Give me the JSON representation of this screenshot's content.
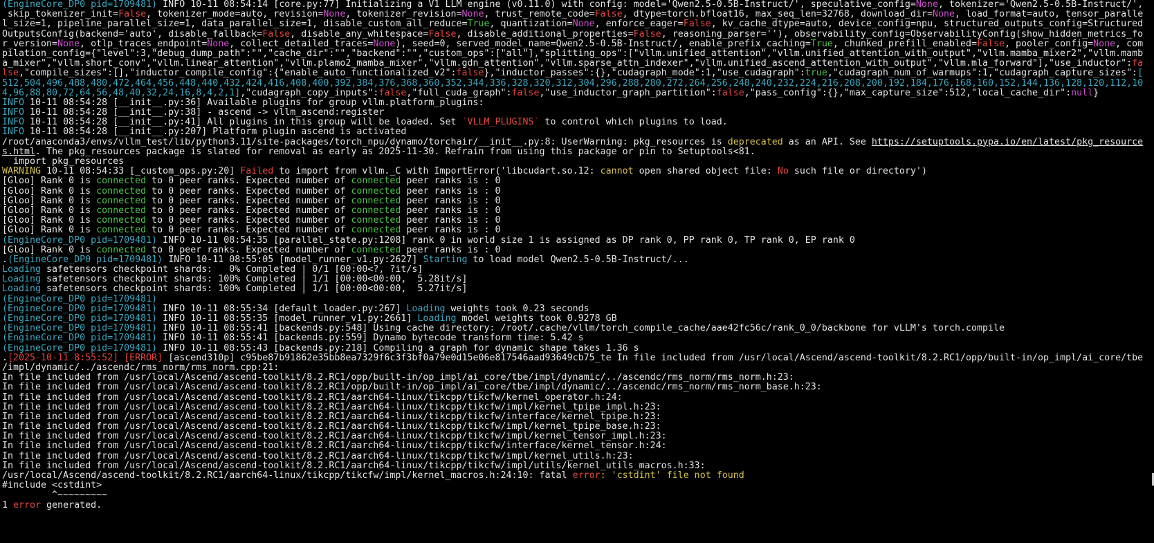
{
  "terminal": {
    "colors": {
      "background": "#000000",
      "default": "#e4e4e4",
      "cyan": "#3aa8c1",
      "red": "#e5453f",
      "green": "#4cc44c",
      "yellow": "#d7c24a",
      "magenta": "#d04fd0"
    },
    "lines": [
      [
        [
          "c",
          "(EngineCore_DP0 pid=1709481) "
        ],
        [
          "d",
          "INFO 10-11 08:54:14 [core.py:77] Initializing a V1 LLM engine (v0.11.0) with config: model='Qwen2.5-0.5B-Instruct/', speculative_config="
        ],
        [
          "m",
          "None"
        ],
        [
          "d",
          ", tokenizer='Qwen2.5-0.5B-Instruct/',"
        ]
      ],
      [
        [
          "d",
          " skip_tokenizer_init="
        ],
        [
          "r",
          "False"
        ],
        [
          "d",
          ", tokenizer_mode=auto, revision="
        ],
        [
          "m",
          "None"
        ],
        [
          "d",
          ", tokenizer_revision="
        ],
        [
          "m",
          "None"
        ],
        [
          "d",
          ", trust_remote_code="
        ],
        [
          "r",
          "False"
        ],
        [
          "d",
          ", dtype=torch.bfloat16, max_seq_len=32768, download_dir="
        ],
        [
          "m",
          "None"
        ],
        [
          "d",
          ", load_format=auto, tensor_paralle"
        ]
      ],
      [
        [
          "d",
          "l_size=1, pipeline_parallel_size=1, data_parallel_size=1, disable_custom_all_reduce="
        ],
        [
          "g",
          "True"
        ],
        [
          "d",
          ", quantization="
        ],
        [
          "m",
          "None"
        ],
        [
          "d",
          ", enforce_eager="
        ],
        [
          "r",
          "False"
        ],
        [
          "d",
          ", kv_cache_dtype=auto, device_config=npu, structured_outputs_config=Structured"
        ]
      ],
      [
        [
          "d",
          "OutputsConfig(backend='auto', disable_fallback="
        ],
        [
          "r",
          "False"
        ],
        [
          "d",
          ", disable_any_whitespace="
        ],
        [
          "r",
          "False"
        ],
        [
          "d",
          ", disable_additional_properties="
        ],
        [
          "r",
          "False"
        ],
        [
          "d",
          ", reasoning_parser=''), observability_config=ObservabilityConfig(show_hidden_metrics_fo"
        ]
      ],
      [
        [
          "d",
          "r_version="
        ],
        [
          "m",
          "None"
        ],
        [
          "d",
          ", otlp_traces_endpoint="
        ],
        [
          "m",
          "None"
        ],
        [
          "d",
          ", collect_detailed_traces="
        ],
        [
          "m",
          "None"
        ],
        [
          "d",
          "), seed=0, served_model_name=Qwen2.5-0.5B-Instruct/, enable_prefix_caching="
        ],
        [
          "g",
          "True"
        ],
        [
          "d",
          ", chunked_prefill_enabled="
        ],
        [
          "r",
          "False"
        ],
        [
          "d",
          ", pooler_config="
        ],
        [
          "m",
          "None"
        ],
        [
          "d",
          ", com"
        ]
      ],
      [
        [
          "d",
          "pilation_config={\"level\":3,\"debug_dump_path\":\"\",\"cache_dir\":\"\",\"backend\":\"\",\"custom_ops\":[\"all\"],\"splitting_ops\":[\"vllm.unified_attention\",\"vllm.unified_attention_with_output\",\"vllm.mamba_mixer2\",\"vllm.mamb"
        ]
      ],
      [
        [
          "d",
          "a_mixer\",\"vllm.short_conv\",\"vllm.linear_attention\",\"vllm.plamo2_mamba_mixer\",\"vllm.gdn_attention\",\"vllm.sparse_attn_indexer\",\"vllm.unified_ascend_attention_with_output\",\"vllm.mla_forward\"],\"use_inductor\":"
        ],
        [
          "r",
          "fa"
        ]
      ],
      [
        [
          "r",
          "lse"
        ],
        [
          "d",
          ",\"compile_sizes\":[],\"inductor_compile_config\":{\"enable_auto_functionalized_v2\":"
        ],
        [
          "r",
          "false"
        ],
        [
          "d",
          "},\"inductor_passes\":{},\"cudagraph_mode\":1,\"use_cudagraph\":"
        ],
        [
          "g",
          "true"
        ],
        [
          "d",
          ",\"cudagraph_num_of_warmups\":1,\"cudagraph_capture_sizes\":"
        ],
        [
          "c",
          "["
        ]
      ],
      [
        [
          "c",
          "512,504,496,488,480,472,464,456,448,440,432,424,416,408,400,392,384,376,368,360,352,344,336,328,320,312,304,296,288,280,272,264,256,248,240,232,224,216,208,200,192,184,176,168,160,152,144,136,128,120,112,10"
        ]
      ],
      [
        [
          "c",
          "4,96,88,80,72,64,56,48,40,32,24,16,8,4,2,1]"
        ],
        [
          "d",
          ",\"cudagraph_copy_inputs\":"
        ],
        [
          "r",
          "false"
        ],
        [
          "d",
          ",\"full_cuda_graph\":"
        ],
        [
          "r",
          "false"
        ],
        [
          "d",
          ",\"use_inductor_graph_partition\":"
        ],
        [
          "r",
          "false"
        ],
        [
          "d",
          ",\"pass_config\":{},\"max_capture_size\":512,\"local_cache_dir\":"
        ],
        [
          "m",
          "null"
        ],
        [
          "d",
          "}"
        ]
      ],
      [
        [
          "c",
          "INFO"
        ],
        [
          "d",
          " 10-11 08:54:28 [__init__.py:36] Available plugins for group vllm.platform_plugins:"
        ]
      ],
      [
        [
          "c",
          "INFO"
        ],
        [
          "d",
          " 10-11 08:54:28 [__init__.py:38] - ascend -> vllm_ascend:register"
        ]
      ],
      [
        [
          "c",
          "INFO"
        ],
        [
          "d",
          " 10-11 08:54:28 [__init__.py:41] All plugins in this group will be loaded. Set "
        ],
        [
          "r",
          "`VLLM_PLUGINS`"
        ],
        [
          "d",
          " to control which plugins to load."
        ]
      ],
      [
        [
          "c",
          "INFO"
        ],
        [
          "d",
          " 10-11 08:54:28 [__init__.py:207] Platform plugin ascend is activated"
        ]
      ],
      [
        [
          "d",
          "/root/anaconda3/envs/vllm_test/lib/python3.11/site-packages/torch_npu/dynamo/torchair/__init__.py:8: UserWarning: pkg_resources is "
        ],
        [
          "y",
          "deprecated"
        ],
        [
          "d",
          " as an API. See "
        ],
        [
          "l",
          "https://setuptools.pypa.io/en/latest/pkg_resource"
        ]
      ],
      [
        [
          "l",
          "s.html"
        ],
        [
          "d",
          ". The pkg_resources package is slated for removal as early as 2025-11-30. Refrain from using this package or pin to Setuptools<81."
        ]
      ],
      [
        [
          "d",
          "  import pkg_resources"
        ]
      ],
      [
        [
          "y",
          "WARNING"
        ],
        [
          "d",
          " 10-11 08:54:33 [_custom_ops.py:20] "
        ],
        [
          "r",
          "Failed"
        ],
        [
          "d",
          " to import from vllm._C with ImportError('libcudart.so.12: "
        ],
        [
          "y",
          "cannot"
        ],
        [
          "d",
          " open shared object file: "
        ],
        [
          "r",
          "No"
        ],
        [
          "d",
          " such file or directory')"
        ]
      ],
      [
        [
          "d",
          "[Gloo] Rank 0 is "
        ],
        [
          "g",
          "connected"
        ],
        [
          "d",
          " to 0 peer ranks. Expected number of "
        ],
        [
          "g",
          "connected"
        ],
        [
          "d",
          " peer ranks is : 0"
        ]
      ],
      [
        [
          "d",
          "[Gloo] Rank 0 is "
        ],
        [
          "g",
          "connected"
        ],
        [
          "d",
          " to 0 peer ranks. Expected number of "
        ],
        [
          "g",
          "connected"
        ],
        [
          "d",
          " peer ranks is : 0"
        ]
      ],
      [
        [
          "d",
          "[Gloo] Rank 0 is "
        ],
        [
          "g",
          "connected"
        ],
        [
          "d",
          " to 0 peer ranks. Expected number of "
        ],
        [
          "g",
          "connected"
        ],
        [
          "d",
          " peer ranks is : 0"
        ]
      ],
      [
        [
          "d",
          "[Gloo] Rank 0 is "
        ],
        [
          "g",
          "connected"
        ],
        [
          "d",
          " to 0 peer ranks. Expected number of "
        ],
        [
          "g",
          "connected"
        ],
        [
          "d",
          " peer ranks is : 0"
        ]
      ],
      [
        [
          "d",
          "[Gloo] Rank 0 is "
        ],
        [
          "g",
          "connected"
        ],
        [
          "d",
          " to 0 peer ranks. Expected number of "
        ],
        [
          "g",
          "connected"
        ],
        [
          "d",
          " peer ranks is : 0"
        ]
      ],
      [
        [
          "d",
          "[Gloo] Rank 0 is "
        ],
        [
          "g",
          "connected"
        ],
        [
          "d",
          " to 0 peer ranks. Expected number of "
        ],
        [
          "g",
          "connected"
        ],
        [
          "d",
          " peer ranks is : 0"
        ]
      ],
      [
        [
          "c",
          "(EngineCore_DP0 pid=1709481) "
        ],
        [
          "d",
          "INFO 10-11 08:54:35 [parallel_state.py:1208] rank 0 in world size 1 is assigned as DP rank 0, PP rank 0, TP rank 0, EP rank 0"
        ]
      ],
      [
        [
          "d",
          "[Gloo] Rank 0 is "
        ],
        [
          "g",
          "connected"
        ],
        [
          "d",
          " to 0 peer ranks. Expected number of "
        ],
        [
          "g",
          "connected"
        ],
        [
          "d",
          " peer ranks is : 0"
        ]
      ],
      [
        [
          "d",
          "."
        ],
        [
          "c",
          "(EngineCore_DP0 pid=1709481) "
        ],
        [
          "d",
          "INFO 10-11 08:55:05 [model_runner_v1.py:2627] "
        ],
        [
          "c",
          "Starting"
        ],
        [
          "d",
          " to load model Qwen2.5-0.5B-Instruct/..."
        ]
      ],
      [
        [
          "c",
          "Loading"
        ],
        [
          "d",
          " safetensors checkpoint shards:   0% Completed | 0/1 [00:00<?, ?it/s]"
        ]
      ],
      [
        [
          "c",
          "Loading"
        ],
        [
          "d",
          " safetensors checkpoint shards: 100% Completed | 1/1 [00:00<00:00,  5.28it/s]"
        ]
      ],
      [
        [
          "c",
          "Loading"
        ],
        [
          "d",
          " safetensors checkpoint shards: 100% Completed | 1/1 [00:00<00:00,  5.27it/s]"
        ]
      ],
      [
        [
          "c",
          "(EngineCore_DP0 pid=1709481)"
        ]
      ],
      [
        [
          "c",
          "(EngineCore_DP0 pid=1709481) "
        ],
        [
          "d",
          "INFO 10-11 08:55:34 [default_loader.py:267] "
        ],
        [
          "c",
          "Loading"
        ],
        [
          "d",
          " weights took 0.23 seconds"
        ]
      ],
      [
        [
          "c",
          "(EngineCore_DP0 pid=1709481) "
        ],
        [
          "d",
          "INFO 10-11 08:55:35 [model_runner_v1.py:2661] "
        ],
        [
          "c",
          "Loading"
        ],
        [
          "d",
          " model weights took 0.9278 GB"
        ]
      ],
      [
        [
          "c",
          "(EngineCore_DP0 pid=1709481) "
        ],
        [
          "d",
          "INFO 10-11 08:55:41 [backends.py:548] Using cache directory: /root/.cache/vllm/torch_compile_cache/aae42fc56c/rank_0_0/backbone for vLLM's torch.compile"
        ]
      ],
      [
        [
          "c",
          "(EngineCore_DP0 pid=1709481) "
        ],
        [
          "d",
          "INFO 10-11 08:55:41 [backends.py:559] Dynamo bytecode transform time: 5.42 s"
        ]
      ],
      [
        [
          "c",
          "(EngineCore_DP0 pid=1709481) "
        ],
        [
          "d",
          "INFO 10-11 08:55:43 [backends.py:218] Compiling a graph for dynamic shape takes 1.36 s"
        ]
      ],
      [
        [
          "d",
          "."
        ],
        [
          "r",
          "[2025-10-11 8:55:52]"
        ],
        [
          "d",
          " "
        ],
        [
          "r",
          "[ERROR]"
        ],
        [
          "d",
          " [ascend310p] c95be87b91862e35bb8ea7329f6c3f3bf0a79e0d15e06e817546aad93649cb75_te In file included from /usr/local/Ascend/ascend-toolkit/8.2.RC1/opp/built-in/op_impl/ai_core/tbe"
        ]
      ],
      [
        [
          "d",
          "/impl/dynamic/../ascendc/rms_norm/rms_norm.cpp:21:"
        ]
      ],
      [
        [
          "d",
          "In file included from /usr/local/Ascend/ascend-toolkit/8.2.RC1/opp/built-in/op_impl/ai_core/tbe/impl/dynamic/../ascendc/rms_norm/rms_norm.h:23:"
        ]
      ],
      [
        [
          "d",
          "In file included from /usr/local/Ascend/ascend-toolkit/8.2.RC1/opp/built-in/op_impl/ai_core/tbe/impl/dynamic/../ascendc/rms_norm/rms_norm_base.h:23:"
        ]
      ],
      [
        [
          "d",
          "In file included from /usr/local/Ascend/ascend-toolkit/8.2.RC1/aarch64-linux/tikcpp/tikcfw/kernel_operator.h:24:"
        ]
      ],
      [
        [
          "d",
          "In file included from /usr/local/Ascend/ascend-toolkit/8.2.RC1/aarch64-linux/tikcpp/tikcfw/impl/kernel_tpipe_impl.h:23:"
        ]
      ],
      [
        [
          "d",
          "In file included from /usr/local/Ascend/ascend-toolkit/8.2.RC1/aarch64-linux/tikcpp/tikcfw/interface/kernel_tpipe.h:23:"
        ]
      ],
      [
        [
          "d",
          "In file included from /usr/local/Ascend/ascend-toolkit/8.2.RC1/aarch64-linux/tikcpp/tikcfw/impl/kernel_tpipe_base.h:23:"
        ]
      ],
      [
        [
          "d",
          "In file included from /usr/local/Ascend/ascend-toolkit/8.2.RC1/aarch64-linux/tikcpp/tikcfw/impl/kernel_tensor_impl.h:23:"
        ]
      ],
      [
        [
          "d",
          "In file included from /usr/local/Ascend/ascend-toolkit/8.2.RC1/aarch64-linux/tikcpp/tikcfw/interface/kernel_tensor.h:24:"
        ]
      ],
      [
        [
          "d",
          "In file included from /usr/local/Ascend/ascend-toolkit/8.2.RC1/aarch64-linux/tikcpp/tikcfw/impl/kernel_utils.h:23:"
        ]
      ],
      [
        [
          "d",
          "In file included from /usr/local/Ascend/ascend-toolkit/8.2.RC1/aarch64-linux/tikcpp/tikcfw/impl/utils/kernel_utils_macros.h:33:"
        ]
      ],
      [
        [
          "d",
          "/usr/local/Ascend/ascend-toolkit/8.2.RC1/aarch64-linux/tikcpp/tikcfw/impl/kernel_macros.h:24:10: fatal "
        ],
        [
          "r",
          "error"
        ],
        [
          "y",
          ": 'cstdint' file not found"
        ]
      ],
      [
        [
          "d",
          "#include <cstdint>"
        ]
      ],
      [
        [
          "d",
          "         ^~~~~~~~~~"
        ]
      ],
      [
        [
          "d",
          "1 "
        ],
        [
          "r",
          "error"
        ],
        [
          "d",
          " generated."
        ]
      ]
    ]
  }
}
